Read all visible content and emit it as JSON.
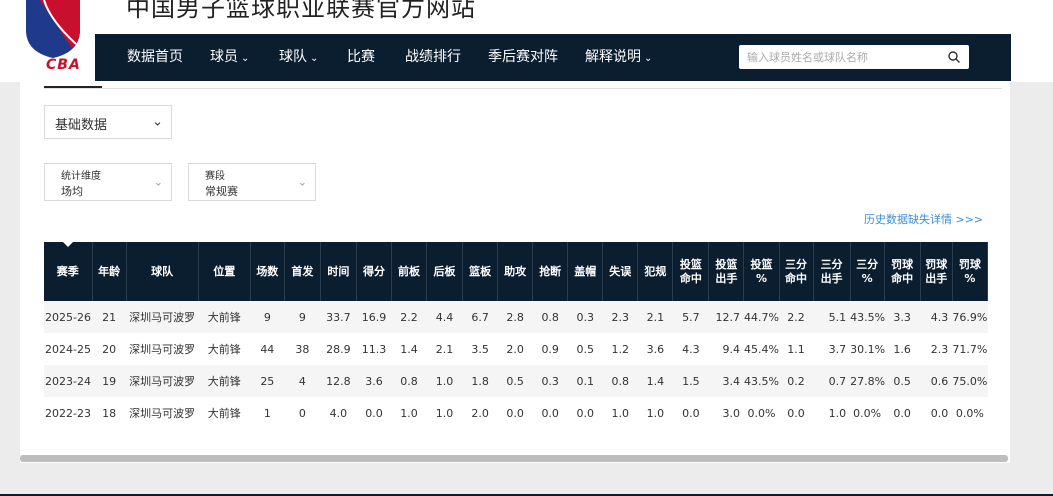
{
  "site": {
    "title": "中国男子篮球职业联赛官方网站",
    "logo_text": "CBA",
    "logo_icon": "cba-basketball-logo"
  },
  "nav": {
    "items": [
      {
        "label": "数据首页",
        "dropdown": false
      },
      {
        "label": "球员",
        "dropdown": true
      },
      {
        "label": "球队",
        "dropdown": true
      },
      {
        "label": "比赛",
        "dropdown": false
      },
      {
        "label": "战绩排行",
        "dropdown": false
      },
      {
        "label": "季后赛对阵",
        "dropdown": false
      },
      {
        "label": "解释说明",
        "dropdown": true
      }
    ],
    "search_placeholder": "输入球员姓名或球队名称",
    "search_icon": "search-icon"
  },
  "filters": {
    "data_type": "基础数据",
    "stat_dimension": {
      "label": "统计维度",
      "value": "场均"
    },
    "stage": {
      "label": "赛段",
      "value": "常规赛"
    }
  },
  "history_link": "历史数据缺失详情 >>>",
  "table": {
    "headers": [
      [
        "赛季"
      ],
      [
        "年龄"
      ],
      [
        "球队"
      ],
      [
        "位置"
      ],
      [
        "场数"
      ],
      [
        "首发"
      ],
      [
        "时间"
      ],
      [
        "得分"
      ],
      [
        "前板"
      ],
      [
        "后板"
      ],
      [
        "篮板"
      ],
      [
        "助攻"
      ],
      [
        "抢断"
      ],
      [
        "盖帽"
      ],
      [
        "失误"
      ],
      [
        "犯规"
      ],
      [
        "投篮",
        "命中"
      ],
      [
        "投篮",
        "出手"
      ],
      [
        "投篮",
        "%"
      ],
      [
        "三分",
        "命中"
      ],
      [
        "三分",
        "出手"
      ],
      [
        "三分",
        "%"
      ],
      [
        "罚球",
        "命中"
      ],
      [
        "罚球",
        "出手"
      ],
      [
        "罚球",
        "%"
      ]
    ],
    "rows": [
      [
        "2025-26",
        "21",
        "深圳马可波罗",
        "大前锋",
        "9",
        "9",
        "33.7",
        "16.9",
        "2.2",
        "4.4",
        "6.7",
        "2.8",
        "0.8",
        "0.3",
        "2.3",
        "2.1",
        "5.7",
        "12.7",
        "44.7%",
        "2.2",
        "5.1",
        "43.5%",
        "3.3",
        "4.3",
        "76.9%"
      ],
      [
        "2024-25",
        "20",
        "深圳马可波罗",
        "大前锋",
        "44",
        "38",
        "28.9",
        "11.3",
        "1.4",
        "2.1",
        "3.5",
        "2.0",
        "0.9",
        "0.5",
        "1.2",
        "3.6",
        "4.3",
        "9.4",
        "45.4%",
        "1.1",
        "3.7",
        "30.1%",
        "1.6",
        "2.3",
        "71.7%"
      ],
      [
        "2023-24",
        "19",
        "深圳马可波罗",
        "大前锋",
        "25",
        "4",
        "12.8",
        "3.6",
        "0.8",
        "1.0",
        "1.8",
        "0.5",
        "0.3",
        "0.1",
        "0.8",
        "1.4",
        "1.5",
        "3.4",
        "43.5%",
        "0.2",
        "0.7",
        "27.8%",
        "0.5",
        "0.6",
        "75.0%"
      ],
      [
        "2022-23",
        "18",
        "深圳马可波罗",
        "大前锋",
        "1",
        "0",
        "4.0",
        "0.0",
        "1.0",
        "1.0",
        "2.0",
        "0.0",
        "0.0",
        "0.0",
        "1.0",
        "1.0",
        "0.0",
        "3.0",
        "0.0%",
        "0.0",
        "1.0",
        "0.0%",
        "0.0",
        "0.0",
        "0.0%"
      ]
    ]
  },
  "colors": {
    "nav_bg": "#0b1e30",
    "link": "#3b8fd9",
    "brand_red": "#c8102e"
  }
}
